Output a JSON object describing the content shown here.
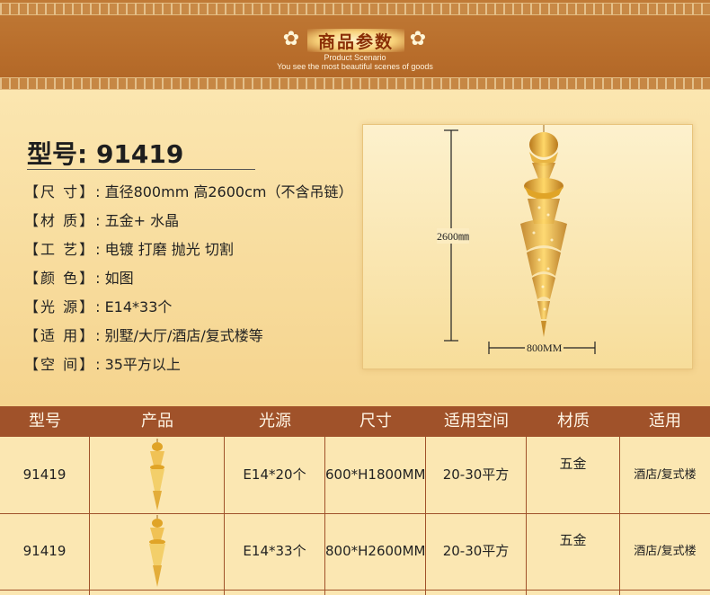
{
  "header": {
    "title": "商品参数",
    "subtitle": "Product Scenario",
    "tagline": "You see the most beautiful scenes of goods"
  },
  "model": {
    "label": "型号:",
    "number": "91419"
  },
  "specs": [
    {
      "label": "【尺 寸】",
      "value": ": 直径800mm 高2600cm（不含吊链）"
    },
    {
      "label": "【材 质】",
      "value": ": 五金+    水晶"
    },
    {
      "label": "【工 艺】",
      "value": ": 电镀 打磨 抛光 切割"
    },
    {
      "label": "【颜 色】",
      "value": ": 如图"
    },
    {
      "label": "【光 源】",
      "value": ": E14*33个"
    },
    {
      "label": "【适 用】",
      "value": ": 别墅/大厅/酒店/复式楼等"
    },
    {
      "label": "【空 间】",
      "value": ": 35平方以上"
    }
  ],
  "photo": {
    "height_label": "2600㎜",
    "width_label": "800MM"
  },
  "table": {
    "headers": [
      "型号",
      "产品",
      "光源",
      "尺寸",
      "适用空间",
      "材质",
      "适用"
    ],
    "rows": [
      {
        "model": "91419",
        "light": "E14*20个",
        "size": "600*H1800MM",
        "space": "20-30平方",
        "material": "五金",
        "usage": "酒店/复式楼"
      },
      {
        "model": "91419",
        "light": "E14*33个",
        "size": "800*H2600MM",
        "space": "20-30平方",
        "material": "五金",
        "usage": "酒店/复式楼"
      }
    ]
  },
  "colors": {
    "header_bg": "#b86d2b",
    "table_header_bg": "#a0522a",
    "gold": "#e0a427"
  },
  "icons": [
    "flower-ornament-icon"
  ]
}
